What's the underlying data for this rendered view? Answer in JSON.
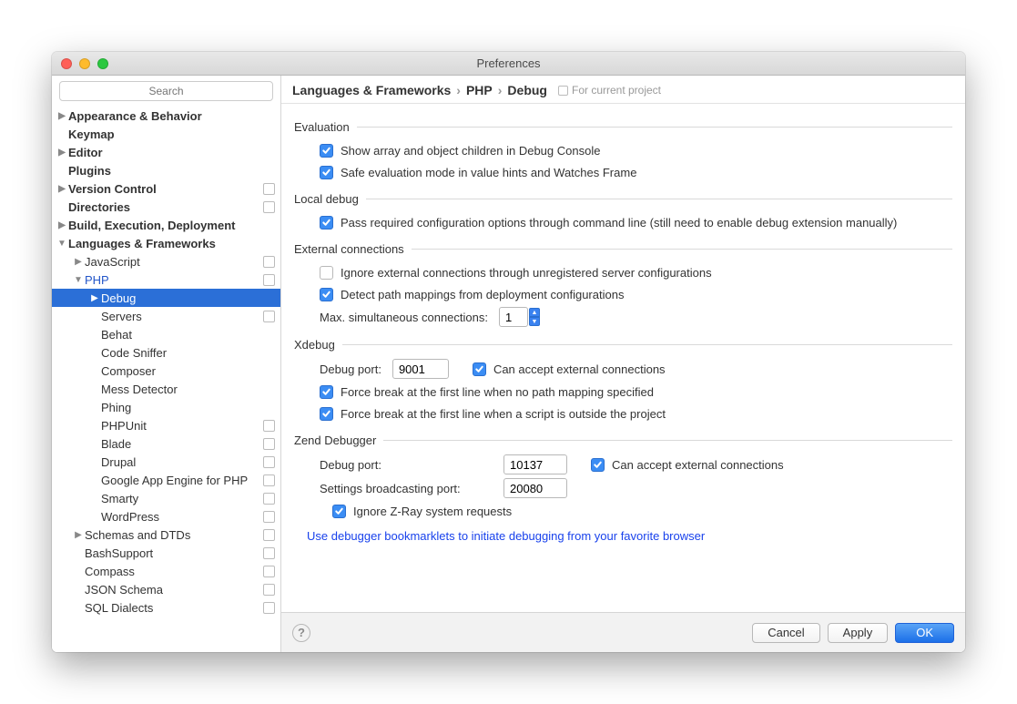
{
  "window": {
    "title": "Preferences"
  },
  "search": {
    "placeholder": "Search"
  },
  "tree": {
    "items": [
      {
        "label": "Appearance & Behavior",
        "indent": 0,
        "disclosure": "right",
        "bold": true
      },
      {
        "label": "Keymap",
        "indent": 0,
        "bold": true
      },
      {
        "label": "Editor",
        "indent": 0,
        "disclosure": "right",
        "bold": true
      },
      {
        "label": "Plugins",
        "indent": 0,
        "bold": true
      },
      {
        "label": "Version Control",
        "indent": 0,
        "disclosure": "right",
        "bold": true,
        "badge": true
      },
      {
        "label": "Directories",
        "indent": 0,
        "bold": true,
        "badge": true
      },
      {
        "label": "Build, Execution, Deployment",
        "indent": 0,
        "disclosure": "right",
        "bold": true
      },
      {
        "label": "Languages & Frameworks",
        "indent": 0,
        "disclosure": "down",
        "bold": true
      },
      {
        "label": "JavaScript",
        "indent": 1,
        "disclosure": "right",
        "badge": true
      },
      {
        "label": "PHP",
        "indent": 1,
        "disclosure": "down",
        "link": true,
        "badge": true
      },
      {
        "label": "Debug",
        "indent": 2,
        "disclosure": "right",
        "selected": true
      },
      {
        "label": "Servers",
        "indent": 2,
        "badge": true
      },
      {
        "label": "Behat",
        "indent": 2
      },
      {
        "label": "Code Sniffer",
        "indent": 2
      },
      {
        "label": "Composer",
        "indent": 2
      },
      {
        "label": "Mess Detector",
        "indent": 2
      },
      {
        "label": "Phing",
        "indent": 2
      },
      {
        "label": "PHPUnit",
        "indent": 2,
        "badge": true
      },
      {
        "label": "Blade",
        "indent": 2,
        "badge": true
      },
      {
        "label": "Drupal",
        "indent": 2,
        "badge": true
      },
      {
        "label": "Google App Engine for PHP",
        "indent": 2,
        "badge": true
      },
      {
        "label": "Smarty",
        "indent": 2,
        "badge": true
      },
      {
        "label": "WordPress",
        "indent": 2,
        "badge": true
      },
      {
        "label": "Schemas and DTDs",
        "indent": 1,
        "disclosure": "right",
        "badge": true
      },
      {
        "label": "BashSupport",
        "indent": 1,
        "badge": true
      },
      {
        "label": "Compass",
        "indent": 1,
        "badge": true
      },
      {
        "label": "JSON Schema",
        "indent": 1,
        "badge": true
      },
      {
        "label": "SQL Dialects",
        "indent": 1,
        "badge": true
      }
    ]
  },
  "breadcrumb": {
    "a": "Languages & Frameworks",
    "b": "PHP",
    "c": "Debug",
    "scope": "For current project"
  },
  "sections": {
    "evaluation": {
      "title": "Evaluation",
      "opt1": "Show array and object children in Debug Console",
      "opt2": "Safe evaluation mode in value hints and Watches Frame"
    },
    "localdebug": {
      "title": "Local debug",
      "opt1": "Pass required configuration options through command line (still need to enable debug extension manually)"
    },
    "external": {
      "title": "External connections",
      "opt1": "Ignore external connections through unregistered server configurations",
      "opt2": "Detect path mappings from deployment configurations",
      "maxlabel": "Max. simultaneous connections:",
      "maxvalue": "1"
    },
    "xdebug": {
      "title": "Xdebug",
      "portlabel": "Debug port:",
      "portvalue": "9001",
      "accept": "Can accept external connections",
      "opt2": "Force break at the first line when no path mapping specified",
      "opt3": "Force break at the first line when a script is outside the project"
    },
    "zend": {
      "title": "Zend Debugger",
      "portlabel": "Debug port:",
      "portvalue": "10137",
      "accept": "Can accept external connections",
      "bclabel": "Settings broadcasting port:",
      "bcvalue": "20080",
      "zray": "Ignore Z-Ray system requests"
    },
    "link": "Use debugger bookmarklets to initiate debugging from your favorite browser"
  },
  "footer": {
    "cancel": "Cancel",
    "apply": "Apply",
    "ok": "OK"
  }
}
